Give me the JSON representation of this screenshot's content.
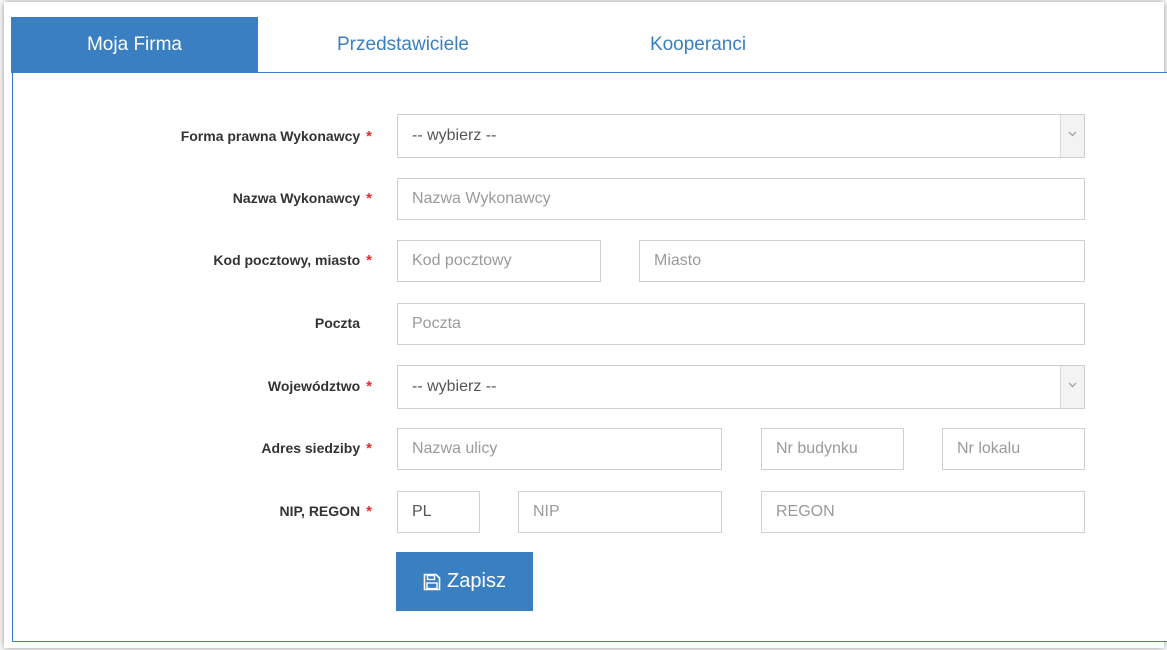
{
  "tabs": [
    {
      "label": "Moja Firma",
      "active": true
    },
    {
      "label": "Przedstawiciele",
      "active": false
    },
    {
      "label": "Kooperanci",
      "active": false
    }
  ],
  "form": {
    "required_mark": "*",
    "forma_prawna": {
      "label": "Forma prawna Wykonawcy",
      "selected": "-- wybierz --"
    },
    "nazwa": {
      "label": "Nazwa Wykonawcy",
      "placeholder": "Nazwa Wykonawcy"
    },
    "kod_miasto": {
      "label": "Kod pocztowy, miasto",
      "kod_placeholder": "Kod pocztowy",
      "miasto_placeholder": "Miasto"
    },
    "poczta": {
      "label": "Poczta",
      "placeholder": "Poczta"
    },
    "wojewodztwo": {
      "label": "Województwo",
      "selected": "-- wybierz --"
    },
    "adres": {
      "label": "Adres siedziby",
      "ulica_placeholder": "Nazwa ulicy",
      "budynek_placeholder": "Nr budynku",
      "lokal_placeholder": "Nr lokalu"
    },
    "nip_regon": {
      "label": "NIP, REGON",
      "prefix_value": "PL",
      "nip_placeholder": "NIP",
      "regon_placeholder": "REGON"
    },
    "save_label": "Zapisz"
  },
  "colors": {
    "accent": "#3a7fc1",
    "required": "#e02b2b"
  },
  "icons": {
    "save": "floppy-disk-icon",
    "select_caret": "chevron-down-icon"
  }
}
